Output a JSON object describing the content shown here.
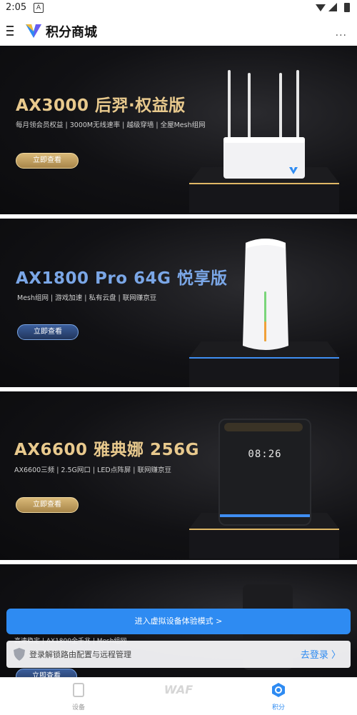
{
  "status_bar": {
    "time": "2:05",
    "app_badge": "A"
  },
  "app_bar": {
    "title": "积分商城",
    "more": "···"
  },
  "banners": [
    {
      "title": "AX3000 后羿·权益版",
      "features": "每月领会员权益 | 3000M无线速率 | 越级穿墙 | 全屋Mesh组网",
      "button": "立即查看",
      "accent": "#e8c98d"
    },
    {
      "title": "AX1800 Pro 64G 悦享版",
      "features": "Mesh组网 | 游戏加速 | 私有云盘 | 联网赚京豆",
      "button": "立即查看",
      "accent": "#7aa6e6"
    },
    {
      "title": "AX6600 雅典娜 256G",
      "features": "AX6600三频 | 2.5G网口 | LED点阵屏 | 联网赚京豆",
      "button": "立即查看",
      "accent": "#e8c98d",
      "clock": "08:26"
    },
    {
      "features": "高速稳定 | AX1800全千兆 | Mesh组网",
      "button": "立即查看"
    }
  ],
  "virtual_mode_button": "进入虚拟设备体验模式 >",
  "login_hint": {
    "text": "登录解锁路由配置与远程管理",
    "action": "去登录 〉"
  },
  "tabs": [
    {
      "label": "设备"
    },
    {
      "label": "WAF"
    },
    {
      "label": "积分"
    }
  ],
  "colors": {
    "primary": "#2e8bf2",
    "gold": "#e8c98d",
    "blue_accent": "#7aa6e6"
  }
}
